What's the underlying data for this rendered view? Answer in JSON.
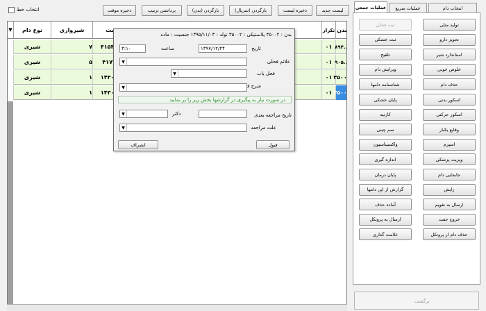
{
  "toolbar": {
    "select_line_label": "انتخاب خط",
    "buttons": [
      "ذخیره موقت",
      "برداشتن ترتیب",
      "بازگردن (بدن)",
      "بازگردن (سریال)",
      "ذخیره لیست",
      "لیست جدید"
    ]
  },
  "grid": {
    "headers": [
      "بدن",
      "تکرار",
      "ثبت",
      "شیرواری",
      "نوع دام"
    ],
    "rows": [
      {
        "badan": "...۸۹۴",
        "tekrar": "۰۱",
        "sabt": "۴۱۵۴۲۲",
        "shir": "۷",
        "type": "شیری"
      },
      {
        "badan": "...۹۰۵",
        "tekrar": "۰۱",
        "sabt": "۴۱۷۷۱",
        "shir": "۵",
        "type": "شیری"
      },
      {
        "badan": "۳۵۰۰۱",
        "tekrar": "۰۱",
        "sabt": "۱۴۳۰۹۷",
        "shir": "۱",
        "type": "شیری"
      },
      {
        "badan": "۳۵۰۰۲",
        "tekrar": "۰۱",
        "sabt": "۱۴۳۰۹۷",
        "shir": "۱",
        "type": "شیری"
      }
    ]
  },
  "panel": {
    "tabs": [
      "عملیات جمعی",
      "عملیات سریع",
      "انتخاب دام"
    ],
    "right_col": [
      "تولید مثلی",
      "تجویز دارو",
      "استاندارد شیر",
      "خلوص خونی",
      "حذف دام",
      "اسکور بدنی",
      "اسکور حرکتی",
      "وقایع یکبار",
      "اسپرم",
      "ویزیت پزشکی",
      "جابجایی دام",
      "زایش",
      "ارسال به تقویم",
      "خروج جفت",
      "حذف دام از پروتکل"
    ],
    "left_col": [
      "ثبت فحلی",
      "ثبت خشکی",
      "تلقیح",
      "ویرایش دام",
      "شناسنامه دامها",
      "پایان خشکی",
      "کارتیه",
      "سم چینی",
      "واکسیناسیون",
      "اندازه گیری",
      "پایان درمان",
      "گزارش از این دامها",
      "آماده حذف",
      "ارسال به پروتکل",
      "علامت گذاری"
    ],
    "bottom_label": "برگشت"
  },
  "dialog": {
    "info": "بدن : ۳۵۰۰۲   پلاستیکی : ۳۵۰۰۲  تولد : ۱۳۹۵/۱۱/۰۳  جنسیت : ماده",
    "date_label": "تاریخ",
    "date_value": "۱۳۹۷/۱۲/۲۴",
    "time_label": "ساعت",
    "time_value": "۳:۱۰",
    "heat_signs_label": "علائم فحلی",
    "heat_type_label": "فحل یاب",
    "heat_desc_label": "شرح فحلی",
    "notice": "در صورت نیاز به پیگیری در گزارشها بخش زیر را پر نمایید",
    "followup_date_label": "تاریخ مراجعه بعدی",
    "doctor_label": "دکتر",
    "reason_label": "علت مراجعه",
    "ok_label": "قبول",
    "cancel_label": "انصراف"
  }
}
